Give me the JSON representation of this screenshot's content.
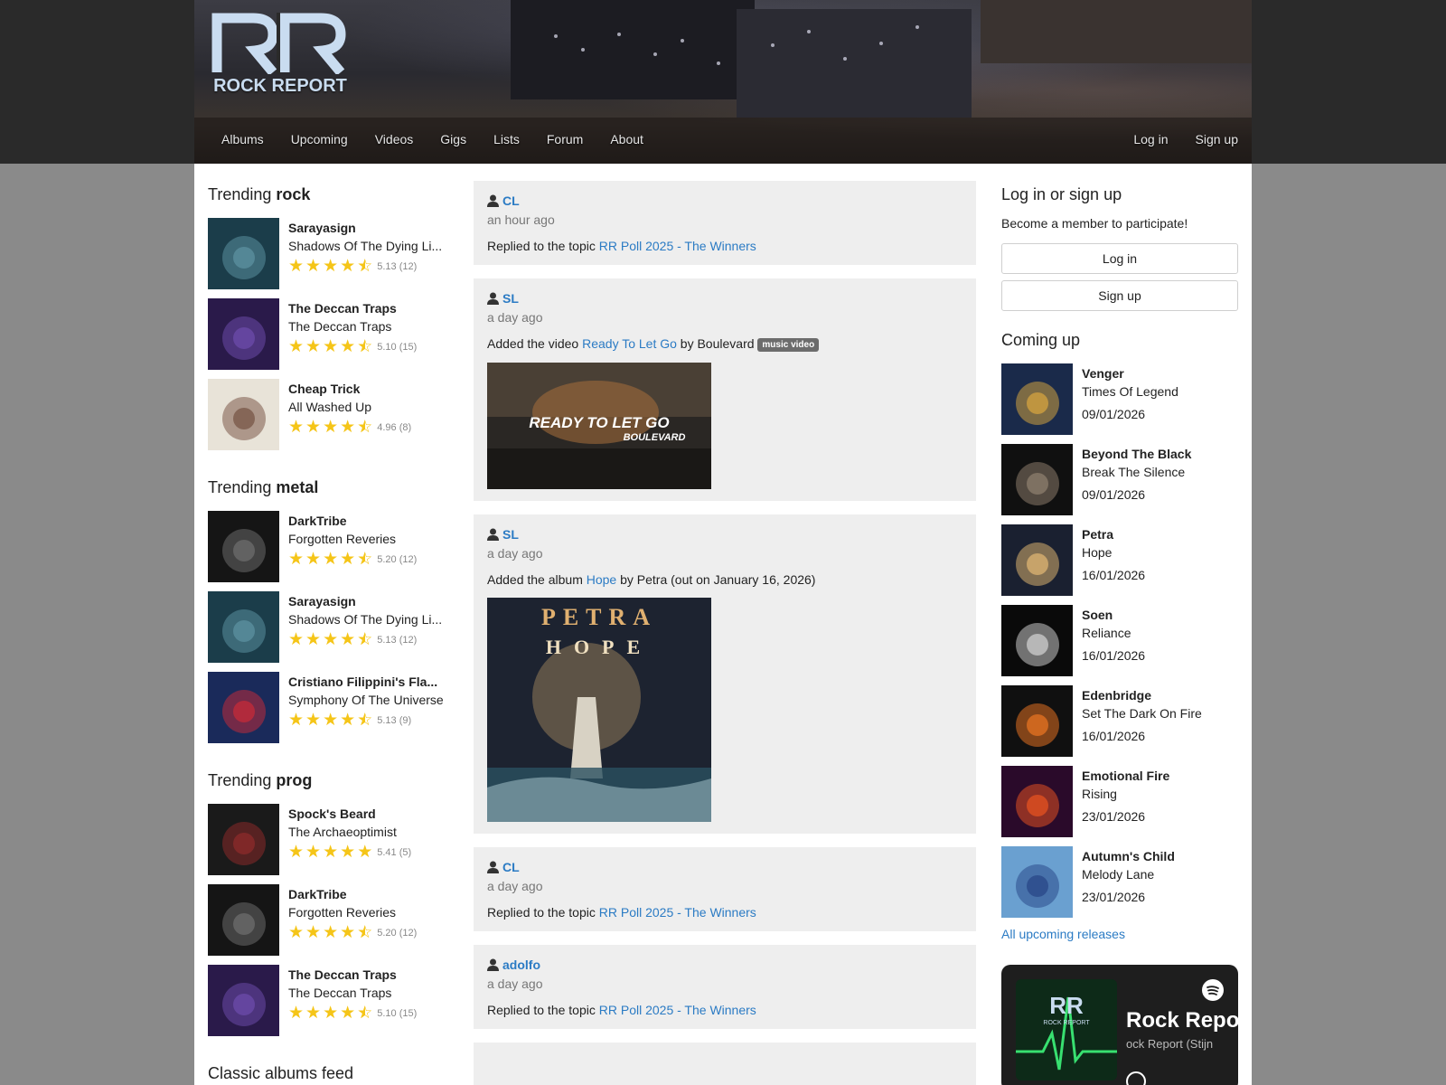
{
  "brand": {
    "logo_letters": "RR",
    "name": "ROCK REPORT"
  },
  "nav": {
    "left": [
      "Albums",
      "Upcoming",
      "Videos",
      "Gigs",
      "Lists",
      "Forum",
      "About"
    ],
    "right": [
      "Log in",
      "Sign up"
    ]
  },
  "trending": [
    {
      "label": "Trending",
      "genre": "rock",
      "albums": [
        {
          "artist": "Sarayasign",
          "title": "Shadows Of The Dying Li...",
          "rating": "5.13 (12)",
          "stars": 4.5,
          "colors": [
            "#1b3d4a",
            "#5a8f9e"
          ]
        },
        {
          "artist": "The Deccan Traps",
          "title": "The Deccan Traps",
          "rating": "5.10 (15)",
          "stars": 4.5,
          "colors": [
            "#2a1a4a",
            "#6a4aa8"
          ]
        },
        {
          "artist": "Cheap Trick",
          "title": "All Washed Up",
          "rating": "4.96 (8)",
          "stars": 4.5,
          "colors": [
            "#e8e3d8",
            "#7b5a4a"
          ]
        }
      ]
    },
    {
      "label": "Trending",
      "genre": "metal",
      "albums": [
        {
          "artist": "DarkTribe",
          "title": "Forgotten Reveries",
          "rating": "5.20 (12)",
          "stars": 4.5,
          "colors": [
            "#151515",
            "#6a6a6a"
          ]
        },
        {
          "artist": "Sarayasign",
          "title": "Shadows Of The Dying Li...",
          "rating": "5.13 (12)",
          "stars": 4.5,
          "colors": [
            "#1b3d4a",
            "#5a8f9e"
          ]
        },
        {
          "artist": "Cristiano Filippini's Fla...",
          "title": "Symphony Of The Universe",
          "rating": "5.13 (9)",
          "stars": 4.5,
          "colors": [
            "#1a2a5a",
            "#c02a3a"
          ]
        }
      ]
    },
    {
      "label": "Trending",
      "genre": "prog",
      "albums": [
        {
          "artist": "Spock's Beard",
          "title": "The Archaeoptimist",
          "rating": "5.41 (5)",
          "stars": 5,
          "colors": [
            "#1a1a1a",
            "#8a2a2a"
          ]
        },
        {
          "artist": "DarkTribe",
          "title": "Forgotten Reveries",
          "rating": "5.20 (12)",
          "stars": 4.5,
          "colors": [
            "#151515",
            "#6a6a6a"
          ]
        },
        {
          "artist": "The Deccan Traps",
          "title": "The Deccan Traps",
          "rating": "5.10 (15)",
          "stars": 4.5,
          "colors": [
            "#2a1a4a",
            "#6a4aa8"
          ]
        }
      ]
    }
  ],
  "classic_feed_title": "Classic albums feed",
  "feed": [
    {
      "user": "CL",
      "ago": "an hour ago",
      "pre": "Replied to the topic ",
      "link": "RR Poll 2025 - The Winners",
      "post": ""
    },
    {
      "user": "SL",
      "ago": "a day ago",
      "pre": "Added the video ",
      "link": "Ready To Let Go",
      "post": " by Boulevard ",
      "badge": "music video",
      "media_text": "READY TO LET GO",
      "media_sub": "BOULEVARD"
    },
    {
      "user": "SL",
      "ago": "a day ago",
      "pre": "Added the album ",
      "link": "Hope",
      "post": " by Petra (out on January 16, 2026)",
      "media_title": "PETRA",
      "media_sub": "HOPE"
    },
    {
      "user": "CL",
      "ago": "a day ago",
      "pre": "Replied to the topic ",
      "link": "RR Poll 2025 - The Winners",
      "post": ""
    },
    {
      "user": "adolfo",
      "ago": "a day ago",
      "pre": "Replied to the topic ",
      "link": "RR Poll 2025 - The Winners",
      "post": ""
    }
  ],
  "login": {
    "title": "Log in or sign up",
    "desc": "Become a member to participate!",
    "login": "Log in",
    "signup": "Sign up"
  },
  "coming_up": {
    "title": "Coming up",
    "items": [
      {
        "artist": "Venger",
        "title": "Times Of Legend",
        "date": "09/01/2026",
        "colors": [
          "#1a2a4a",
          "#d0a040"
        ]
      },
      {
        "artist": "Beyond The Black",
        "title": "Break The Silence",
        "date": "09/01/2026",
        "colors": [
          "#101010",
          "#8a7a6a"
        ]
      },
      {
        "artist": "Petra",
        "title": "Hope",
        "date": "16/01/2026",
        "colors": [
          "#1a2030",
          "#d8b070"
        ]
      },
      {
        "artist": "Soen",
        "title": "Reliance",
        "date": "16/01/2026",
        "colors": [
          "#0a0a0a",
          "#c8c8c8"
        ]
      },
      {
        "artist": "Edenbridge",
        "title": "Set The Dark On Fire",
        "date": "16/01/2026",
        "colors": [
          "#101010",
          "#e07020"
        ]
      },
      {
        "artist": "Emotional Fire",
        "title": "Rising",
        "date": "23/01/2026",
        "colors": [
          "#2a0a2a",
          "#e05020"
        ]
      },
      {
        "artist": "Autumn's Child",
        "title": "Melody Lane",
        "date": "23/01/2026",
        "colors": [
          "#6aa0d0",
          "#2a4a8a"
        ]
      }
    ],
    "all_link": "All upcoming releases"
  },
  "spotify": {
    "title": "Rock Repo",
    "subtitle": "ock Report (Stijn",
    "logo_letters": "RR",
    "logo_text": "ROCK REPORT"
  }
}
